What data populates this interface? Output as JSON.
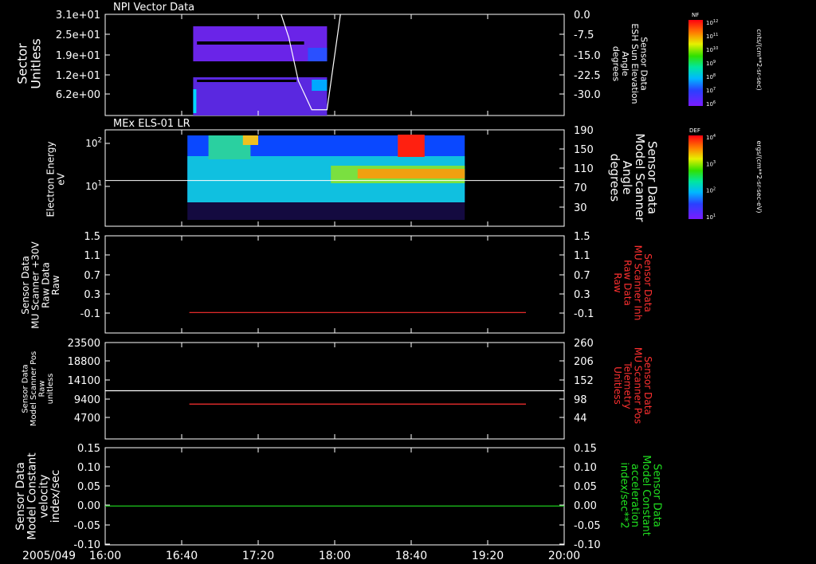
{
  "chart_data": [
    {
      "type": "heatmap",
      "title": "NPI Vector Data",
      "ylabel_left": [
        "Sector",
        "Unitless"
      ],
      "ylabel_right": [
        "Sensor Data",
        "ESH Sun Elevation",
        "Angle",
        "degrees"
      ],
      "yticks_left": [
        "3.1e+01",
        "2.5e+01",
        "1.9e+01",
        "1.2e+01",
        "6.2e+00"
      ],
      "yticks_right": [
        "0.0",
        "-7.5",
        "-15.0",
        "-22.5",
        "-30.0"
      ],
      "ylim_right": [
        -35,
        0
      ],
      "overlay_line": {
        "color": "#ffffff",
        "x": [
          "17:32",
          "17:36",
          "17:41",
          "17:48",
          "17:56",
          "18:03"
        ],
        "y": [
          0,
          -8,
          -23,
          -33,
          -33,
          0
        ]
      },
      "colorbar": {
        "label": "NF",
        "units": "cnts/(cm**2-sr-sec)",
        "ticks": [
          "10^12",
          "10^11",
          "10^10",
          "10^9",
          "10^8",
          "10^7",
          "10^6"
        ]
      }
    },
    {
      "type": "heatmap",
      "title": "MEx ELS-01 LR",
      "ylabel_left": [
        "Electron Energy",
        "eV"
      ],
      "ylabel_right": [
        "Sensor Data",
        "Model Scanner",
        "Angle",
        "degrees"
      ],
      "yticks_left": [
        "10^2",
        "10^1"
      ],
      "yticks_right": [
        "190",
        "150",
        "110",
        "70",
        "30"
      ],
      "ylim_right": [
        0,
        190
      ],
      "overlay_line": {
        "color": "#ffffff",
        "x": [
          "16:00",
          "20:00"
        ],
        "y": [
          90,
          90
        ]
      },
      "colorbar": {
        "label": "DEF",
        "units": "ergs/(cm**2-sr-sec-eV)",
        "ticks": [
          "10^4",
          "10^3",
          "10^2",
          "10^1"
        ]
      }
    },
    {
      "type": "line",
      "ylabel_left": [
        "Sensor Data",
        "MU Scanner +30V",
        "Raw Data",
        "Raw"
      ],
      "ylabel_right": [
        "Sensor Data",
        "MU Scanner Inh",
        "Raw Data",
        "Raw"
      ],
      "yticks_left": [
        "1.5",
        "1.1",
        "0.7",
        "0.3",
        "-0.1"
      ],
      "yticks_right": [
        "1.5",
        "1.1",
        "0.7",
        "0.3",
        "-0.1"
      ],
      "ylim": [
        -0.4,
        1.5
      ],
      "series": [
        {
          "color": "#ff3030",
          "x": [
            "16:44",
            "19:40"
          ],
          "y": [
            0.0,
            0.0
          ]
        }
      ]
    },
    {
      "type": "line",
      "ylabel_left": [
        "Sensor Data",
        "Model Scanner Pos",
        "Raw",
        "unitless"
      ],
      "ylabel_right": [
        "Sensor Data",
        "MU Scanner Pos",
        "Telemetry",
        "Unitless"
      ],
      "yticks_left": [
        "23500",
        "18800",
        "14100",
        "9400",
        "4700"
      ],
      "yticks_right": [
        "260",
        "206",
        "152",
        "98",
        "44"
      ],
      "ylim_left": [
        0,
        23500
      ],
      "ylim_right": [
        0,
        260
      ],
      "series": [
        {
          "color": "#ffffff",
          "x": [
            "16:00",
            "20:00"
          ],
          "y": [
            11750,
            11750
          ]
        },
        {
          "color": "#ff3030",
          "x": [
            "16:44",
            "19:40"
          ],
          "y": [
            8500,
            8500
          ]
        }
      ]
    },
    {
      "type": "line",
      "ylabel_left": [
        "Sensor Data",
        "Model Constant",
        "velocity",
        "index/sec"
      ],
      "ylabel_right": [
        "Sensor Data",
        "Model Constant",
        "acceleration",
        "index/sec**2"
      ],
      "yticks_left": [
        "0.15",
        "0.10",
        "0.05",
        "0.00",
        "-0.05",
        "-0.10"
      ],
      "yticks_right": [
        "0.15",
        "0.10",
        "0.05",
        "0.00",
        "-0.05",
        "-0.10"
      ],
      "ylim": [
        -0.1,
        0.15
      ],
      "series": [
        {
          "color": "#20e020",
          "x": [
            "16:00",
            "20:00"
          ],
          "y": [
            0.0,
            0.0
          ]
        }
      ]
    }
  ],
  "xaxis": {
    "date": "2005/049",
    "ticks": [
      "16:00",
      "16:40",
      "17:20",
      "18:00",
      "18:40",
      "19:20",
      "20:00"
    ],
    "range": [
      "16:00",
      "20:00"
    ]
  },
  "colors": {
    "left_label": "#ffffff",
    "right_label_panel1": "#ffffff",
    "right_label_panel2": "#ffffff",
    "right_label_panel3": "#ff3030",
    "right_label_panel4": "#ff3030",
    "right_label_panel5": "#20e020"
  }
}
